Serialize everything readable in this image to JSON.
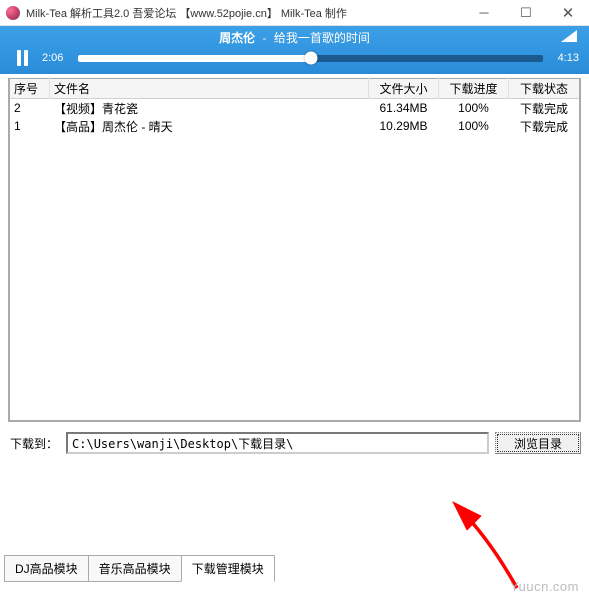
{
  "window": {
    "title": "Milk-Tea 解析工具2.0  吾爱论坛 【www.52pojie.cn】 Milk-Tea 制作"
  },
  "player": {
    "artist": "周杰伦",
    "separator": "-",
    "track": "给我一首歌的时间",
    "time_current": "2:06",
    "time_total": "4:13",
    "progress_pct": 50
  },
  "table": {
    "headers": {
      "idx": "序号",
      "name": "文件名",
      "size": "文件大小",
      "progress": "下载进度",
      "status": "下载状态"
    },
    "rows": [
      {
        "idx": "2",
        "name": "【视频】青花瓷",
        "size": "61.34MB",
        "progress": "100%",
        "status": "下载完成"
      },
      {
        "idx": "1",
        "name": "【高品】周杰伦 - 晴天",
        "size": "10.29MB",
        "progress": "100%",
        "status": "下载完成"
      }
    ]
  },
  "download": {
    "label": "下载到：",
    "path": "C:\\Users\\wanji\\Desktop\\下载目录\\",
    "browse": "浏览目录"
  },
  "tabs": {
    "items": [
      {
        "label": "DJ高品模块",
        "active": false
      },
      {
        "label": "音乐高品模块",
        "active": false
      },
      {
        "label": "下载管理模块",
        "active": true
      }
    ]
  },
  "watermark": "Yuucn.com"
}
